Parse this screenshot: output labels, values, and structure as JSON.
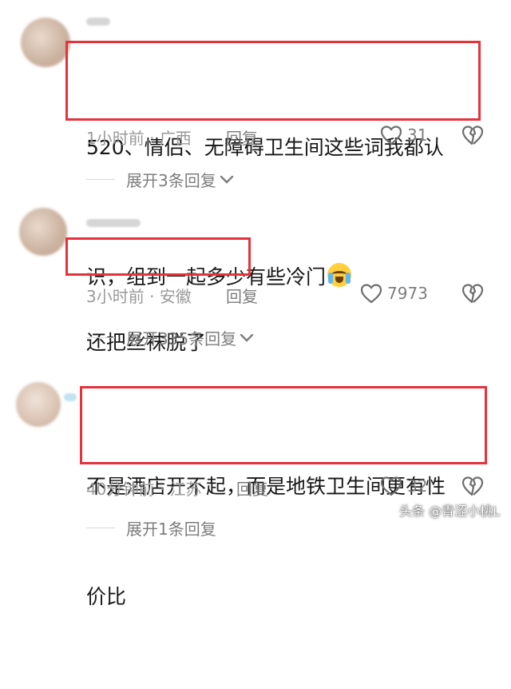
{
  "comments": [
    {
      "text_line1": "520、情侣、无障碍卫生间这些词我都认",
      "text_line2": "识，组到一起多少有些冷门",
      "emoji": "crying-laughing-emoji",
      "time": "1小时前",
      "location": "广西",
      "separator": " · ",
      "reply_label": "回复",
      "likes": "31",
      "expand_label": "展开3条回复"
    },
    {
      "text_line1": "还把丝袜脱了",
      "time": "3小时前",
      "location": "安徽",
      "separator": " · ",
      "reply_label": "回复",
      "likes": "7973",
      "expand_label": "展开335条回复"
    },
    {
      "text_line1": "不是酒店开不起，而是地铁卫生间更有性",
      "text_line2": "价比",
      "time": "40分钟前",
      "location": "江苏",
      "separator": " · ",
      "reply_label": "回复",
      "likes": "32",
      "expand_label": "展开1条回复"
    }
  ],
  "watermark": "头条 @青涩小桃L",
  "colors": {
    "highlight_box": "#e5323b",
    "meta_text": "#9a9a9a",
    "action_text": "#7d7d7d"
  },
  "icons": {
    "like": "heart-icon",
    "dislike": "broken-heart-icon",
    "expand": "chevron-down-icon"
  }
}
